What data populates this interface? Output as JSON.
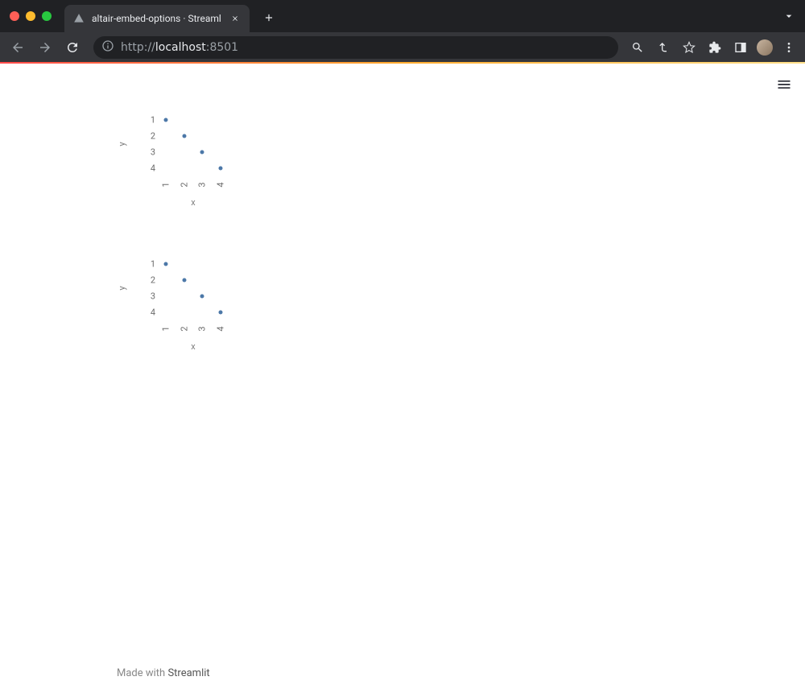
{
  "browser": {
    "tab_title": "altair-embed-options · Streaml",
    "url_protocol": "http://",
    "url_host": "localhost",
    "url_port": ":8501"
  },
  "app": {
    "footer_prefix": "Made with ",
    "footer_link": "Streamlit",
    "hamburger_label": "Menu"
  },
  "chart_data": [
    {
      "type": "scatter",
      "x": [
        1,
        2,
        3,
        4
      ],
      "y": [
        1,
        2,
        3,
        4
      ],
      "x_ticks": [
        "1",
        "2",
        "3",
        "4"
      ],
      "y_ticks": [
        "1",
        "2",
        "3",
        "4"
      ],
      "xlabel": "x",
      "ylabel": "y",
      "point_color": "#4c78a8"
    },
    {
      "type": "scatter",
      "x": [
        1,
        2,
        3,
        4
      ],
      "y": [
        1,
        2,
        3,
        4
      ],
      "x_ticks": [
        "1",
        "2",
        "3",
        "4"
      ],
      "y_ticks": [
        "1",
        "2",
        "3",
        "4"
      ],
      "xlabel": "x",
      "ylabel": "y",
      "point_color": "#4c78a8"
    }
  ]
}
